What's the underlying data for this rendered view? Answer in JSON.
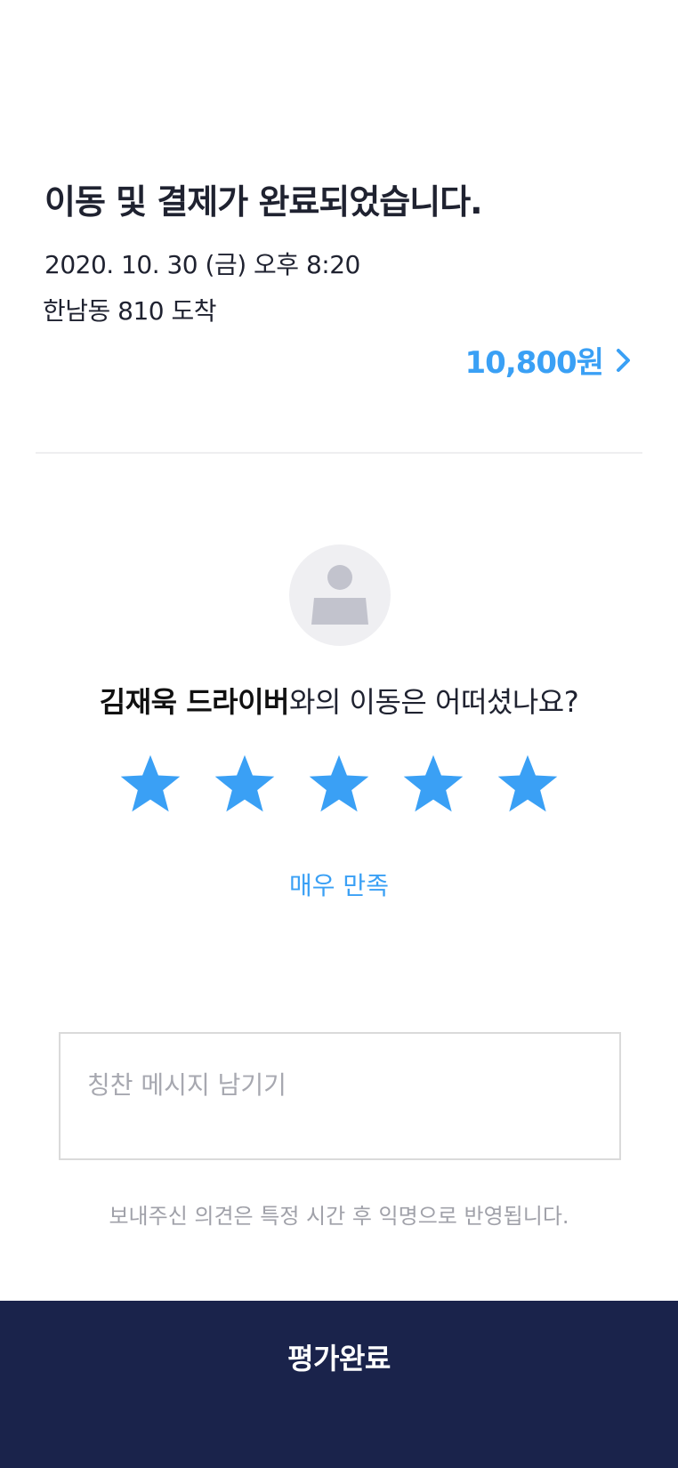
{
  "trip": {
    "status_title": "이동 및 결제가 완료되었습니다.",
    "datetime": "2020. 10. 30 (금) 오후 8:20",
    "arrival": "한남동 810 도착",
    "fare": "10,800원"
  },
  "rating": {
    "driver_name": "김재욱 드라이버",
    "question_suffix": "와의 이동은 어떠셨나요?",
    "stars_selected": 5,
    "stars_total": 5,
    "label": "매우 만족"
  },
  "message": {
    "placeholder": "칭찬 메시지 남기기",
    "value": ""
  },
  "notice": "보내주신 의견은 특정 시간 후 익명으로 반영됩니다.",
  "submit_label": "평가완료",
  "colors": {
    "accent": "#3aa0f5",
    "text_primary": "#1f2230",
    "submit_background": "#1a234b",
    "avatar_background": "#efeff2"
  },
  "icons": {
    "fare_detail": "chevron-right-icon",
    "avatar": "person-placeholder-icon",
    "rating": "star-icon"
  }
}
